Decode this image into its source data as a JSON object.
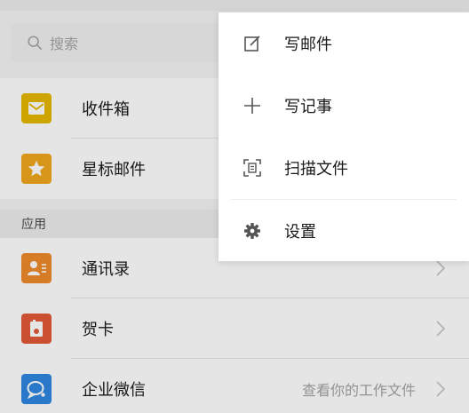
{
  "search": {
    "placeholder": "搜索"
  },
  "mail_items": [
    {
      "label": "收件箱",
      "icon": "envelope-icon",
      "color": "#e6b800"
    },
    {
      "label": "星标邮件",
      "icon": "star-icon",
      "color": "#f0a81e"
    }
  ],
  "section": {
    "label": "应用"
  },
  "app_items": [
    {
      "label": "通讯录",
      "icon": "contacts-icon",
      "color": "#ef8a2b"
    },
    {
      "label": "贺卡",
      "icon": "card-icon",
      "color": "#e25a38"
    },
    {
      "label": "企业微信",
      "subtitle": "查看你的工作文件",
      "icon": "wecom-icon",
      "color": "#2f86e0"
    }
  ],
  "popup_menu": [
    {
      "label": "写邮件",
      "icon": "edit-icon"
    },
    {
      "label": "写记事",
      "icon": "plus-icon"
    },
    {
      "label": "扫描文件",
      "icon": "scan-icon"
    },
    {
      "label": "设置",
      "icon": "gear-icon"
    }
  ]
}
